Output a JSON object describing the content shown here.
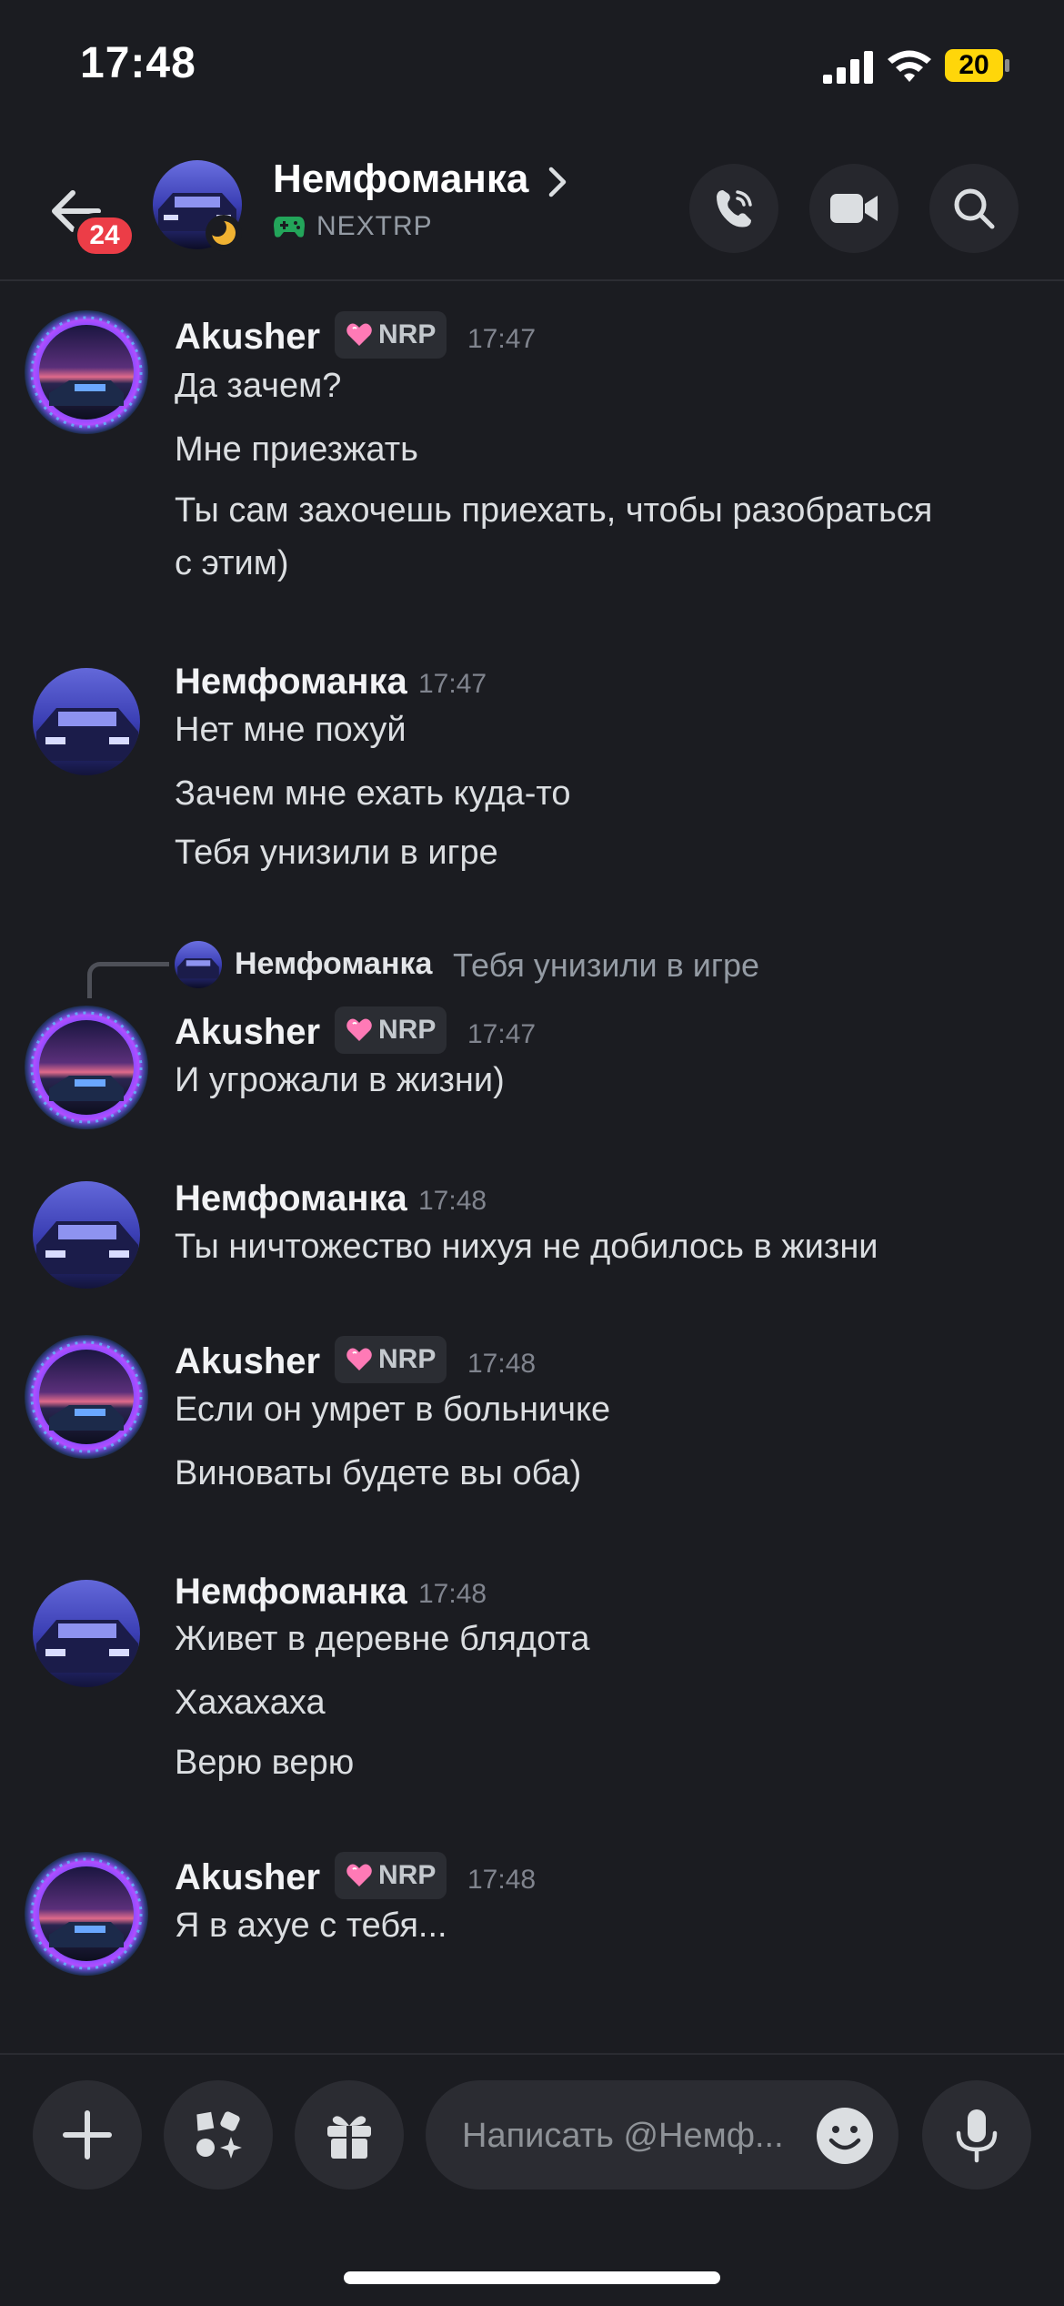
{
  "status_bar": {
    "time": "17:48",
    "battery": "20"
  },
  "header": {
    "back_badge": "24",
    "name": "Немфоманка",
    "activity": "NEXTRP"
  },
  "messages": [
    {
      "user": "Akusher",
      "tag": "NRP",
      "time": "17:47",
      "lines": [
        "Да зачем?",
        "Мне приезжать",
        "Ты сам захочешь приехать, чтобы разобраться",
        "с этим)"
      ]
    },
    {
      "user": "Немфоманка",
      "time": "17:47",
      "lines": [
        "Нет мне похуй",
        "Зачем мне ехать куда-то",
        "Тебя унизили в игре"
      ]
    },
    {
      "user": "Akusher",
      "tag": "NRP",
      "time": "17:47",
      "reply": {
        "user": "Немфоманка",
        "text": "Тебя унизили в игре"
      },
      "lines": [
        "И угрожали в жизни)"
      ]
    },
    {
      "user": "Немфоманка",
      "time": "17:48",
      "lines": [
        "Ты ничтожество нихуя не добилось в жизни"
      ]
    },
    {
      "user": "Akusher",
      "tag": "NRP",
      "time": "17:48",
      "lines": [
        "Если он умрет в больничке",
        "Виноваты будете вы оба)"
      ]
    },
    {
      "user": "Немфоманка",
      "time": "17:48",
      "lines": [
        "Живет в деревне блядота",
        "Хахахаха",
        "Верю верю"
      ]
    },
    {
      "user": "Akusher",
      "tag": "NRP",
      "time": "17:48",
      "lines": [
        "Я в ахуе с тебя..."
      ]
    }
  ],
  "composer": {
    "placeholder": "Написать @Немф..."
  },
  "icons": {
    "back": "arrow-left-icon",
    "call": "phone-call-icon",
    "video": "video-camera-icon",
    "search": "search-icon",
    "attach": "plus-icon",
    "apps": "apps-icon",
    "gift": "gift-icon",
    "emoji": "emoji-face-icon",
    "mic": "microphone-icon"
  },
  "colors": {
    "background": "#1b1c21",
    "badge": "#ec3d47",
    "activity_icon": "#23a55a",
    "tag_heart": "#ff7ab6"
  }
}
